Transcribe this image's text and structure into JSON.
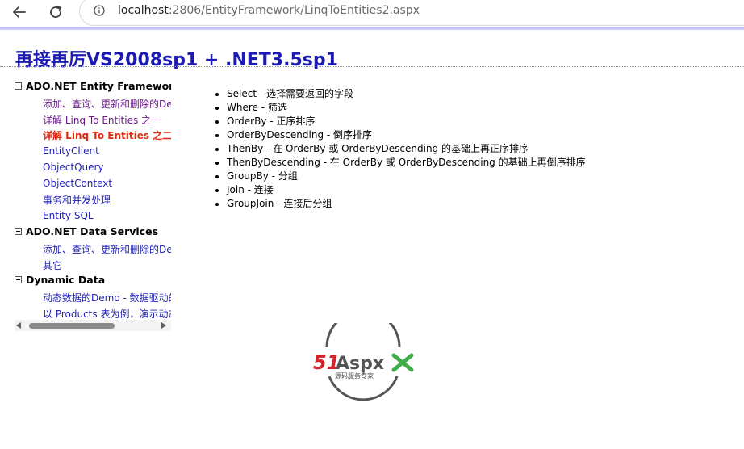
{
  "browser": {
    "url_host": "localhost",
    "url_rest": ":2806/EntityFramework/LinqToEntities2.aspx"
  },
  "page": {
    "title": "再接再厉VS2008sp1 + .NET3.5sp1"
  },
  "tree": {
    "groups": [
      {
        "label": "ADO.NET Entity Framework",
        "items": [
          {
            "label": "添加、查询、更新和删除的De"
          },
          {
            "label": "详解 Linq To Entities 之一"
          },
          {
            "label": "详解 Linq To Entities 之二"
          },
          {
            "label": "EntityClient"
          },
          {
            "label": "ObjectQuery"
          },
          {
            "label": "ObjectContext"
          },
          {
            "label": "事务和并发处理"
          },
          {
            "label": "Entity SQL"
          }
        ]
      },
      {
        "label": "ADO.NET Data Services",
        "items": [
          {
            "label": "添加、查询、更新和删除的De"
          },
          {
            "label": "其它"
          }
        ]
      },
      {
        "label": "Dynamic Data",
        "items": [
          {
            "label": "动态数据的Demo - 数据驱动的"
          },
          {
            "label": "以 Products 表为例，演示动态"
          }
        ]
      }
    ]
  },
  "operators": [
    "Select - 选择需要返回的字段",
    "Where - 筛选",
    "OrderBy - 正序排序",
    "OrderByDescending - 倒序排序",
    "ThenBy - 在 OrderBy 或 OrderByDescending 的基础上再正序排序",
    "ThenByDescending - 在 OrderBy 或 OrderByDescending 的基础上再倒序排序",
    "GroupBy - 分组",
    "Join - 连接",
    "GroupJoin - 连接后分组"
  ],
  "logo": {
    "brand_51": "51",
    "brand_aspx": "Aspx",
    "tagline": "源码服务专家"
  },
  "colors": {
    "title": "#1b1bb3",
    "link": "#1f1fb4",
    "active_link": "#e02b12",
    "visited_link": "#6b1a8a",
    "accent_bar": "#b9b6f0",
    "logo_red": "#d4232b",
    "logo_green": "#3fae49"
  }
}
